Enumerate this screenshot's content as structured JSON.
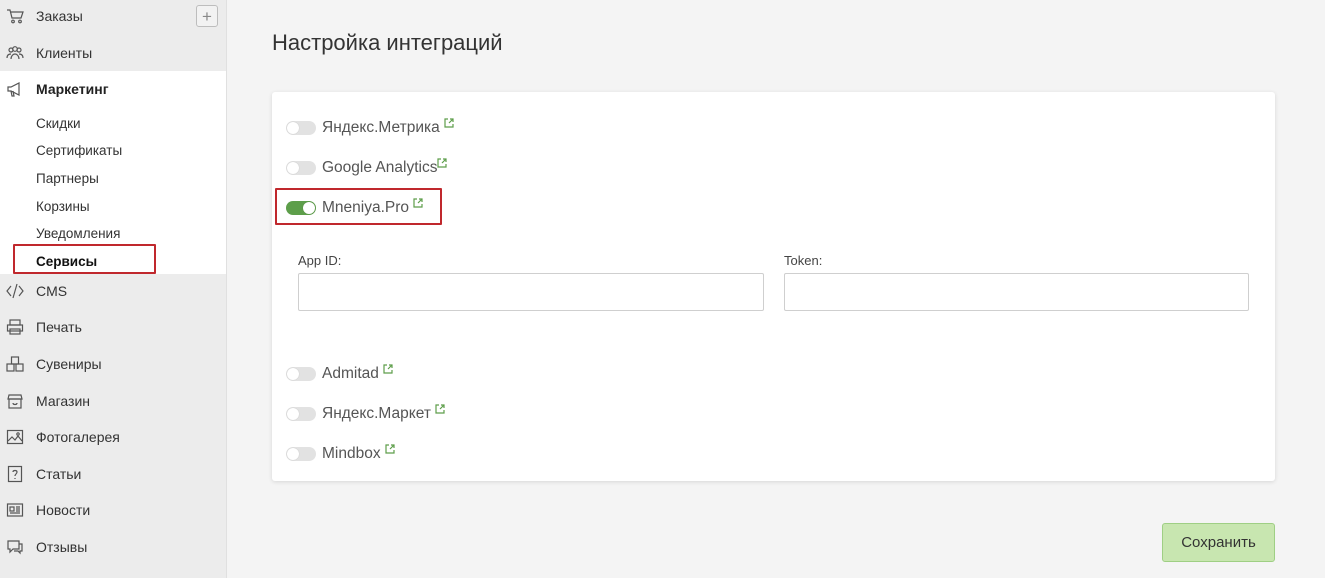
{
  "sidebar": {
    "items": [
      {
        "label": "Заказы",
        "icon": "cart-icon"
      },
      {
        "label": "Клиенты",
        "icon": "users-icon"
      },
      {
        "label": "Маркетинг",
        "icon": "megaphone-icon"
      },
      {
        "label": "CMS",
        "icon": "code-icon"
      },
      {
        "label": "Печать",
        "icon": "printer-icon"
      },
      {
        "label": "Сувениры",
        "icon": "boxes-icon"
      },
      {
        "label": "Магазин",
        "icon": "shop-icon"
      },
      {
        "label": "Фотогалерея",
        "icon": "gallery-icon"
      },
      {
        "label": "Статьи",
        "icon": "article-icon"
      },
      {
        "label": "Новости",
        "icon": "news-icon"
      },
      {
        "label": "Отзывы",
        "icon": "reviews-icon"
      }
    ],
    "marketing_sub": [
      "Скидки",
      "Сертификаты",
      "Партнеры",
      "Корзины",
      "Уведомления",
      "Сервисы"
    ],
    "add_label": "+"
  },
  "main": {
    "title": "Настройка интеграций",
    "services": [
      {
        "label": "Яндекс.Метрика",
        "enabled": false
      },
      {
        "label": "Google Analytics",
        "enabled": false
      },
      {
        "label": "Mneniya.Pro",
        "enabled": true
      },
      {
        "label": "Admitad",
        "enabled": false
      },
      {
        "label": "Яндекс.Маркет",
        "enabled": false
      },
      {
        "label": "Mindbox",
        "enabled": false
      }
    ],
    "fields": {
      "app_id_label": "App ID:",
      "app_id_value": "",
      "token_label": "Token:",
      "token_value": ""
    },
    "save_label": "Сохранить"
  },
  "colors": {
    "accent_green": "#5d9e4a",
    "highlight_red": "#c0282d",
    "save_bg": "#c8e6b0"
  }
}
